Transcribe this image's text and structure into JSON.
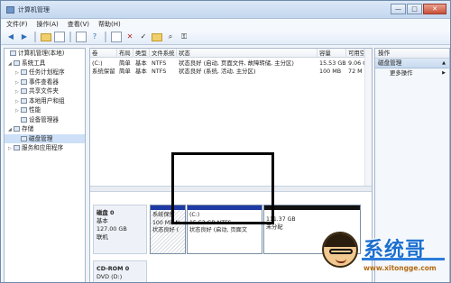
{
  "window": {
    "title": "计算机管理",
    "min_label": "—",
    "max_label": "□",
    "close_label": "✕"
  },
  "menu": [
    "文件(F)",
    "操作(A)",
    "查看(V)",
    "帮助(H)"
  ],
  "toolbar_icons": [
    "back-icon",
    "forward-icon",
    "up-folder-icon",
    "show-tree-icon",
    "properties-icon",
    "help-icon",
    "delete-icon",
    "check-icon",
    "open-folder-icon",
    "search-icon",
    "key-icon"
  ],
  "tree": {
    "root": "计算机管理(本地)",
    "items": [
      {
        "label": "系统工具",
        "level": 1,
        "expand": "◢"
      },
      {
        "label": "任务计划程序",
        "level": 2,
        "expand": "▷"
      },
      {
        "label": "事件查看器",
        "level": 2,
        "expand": "▷"
      },
      {
        "label": "共享文件夹",
        "level": 2,
        "expand": "▷"
      },
      {
        "label": "本地用户和组",
        "level": 2,
        "expand": "▷"
      },
      {
        "label": "性能",
        "level": 2,
        "expand": "▷"
      },
      {
        "label": "设备管理器",
        "level": 2,
        "expand": ""
      },
      {
        "label": "存储",
        "level": 1,
        "expand": "◢"
      },
      {
        "label": "磁盘管理",
        "level": 2,
        "expand": ""
      },
      {
        "label": "服务和应用程序",
        "level": 1,
        "expand": "▷"
      }
    ]
  },
  "volumes": {
    "headers": [
      "卷",
      "布局",
      "类型",
      "文件系统",
      "状态",
      "容量",
      "可用空"
    ],
    "rows": [
      [
        "(C:)",
        "简单",
        "基本",
        "NTFS",
        "状态良好 (启动, 页面文件, 故障转储, 主分区)",
        "15.53 GB",
        "9.06 G"
      ],
      [
        "系统保留",
        "简单",
        "基本",
        "NTFS",
        "状态良好 (系统, 活动, 主分区)",
        "100 MB",
        "72 M"
      ]
    ]
  },
  "disks": [
    {
      "name": "磁盘 0",
      "type": "基本",
      "size": "127.00 GB",
      "status": "联机"
    },
    {
      "name": "CD-ROM 0",
      "type": "DVD (D:)",
      "size": "",
      "status": ""
    }
  ],
  "partitions": [
    {
      "name": "系统保留",
      "detail": "100 MB N",
      "status": "状态良好 ("
    },
    {
      "name": "(C:)",
      "detail": "15.53 GB NTFS",
      "status": "状态良好 (启动, 页面文"
    },
    {
      "name": "",
      "detail": "111.37 GB",
      "status": "未分配"
    }
  ],
  "actions": {
    "header": "操作",
    "section": "磁盘管理",
    "more": "更多操作"
  },
  "watermark": {
    "brand": "系统哥",
    "url": "www.xitongge.com"
  },
  "colors": {
    "primary_partition": "#1e3aa5",
    "unallocated": "#111111",
    "selection": "#cde0f7"
  }
}
